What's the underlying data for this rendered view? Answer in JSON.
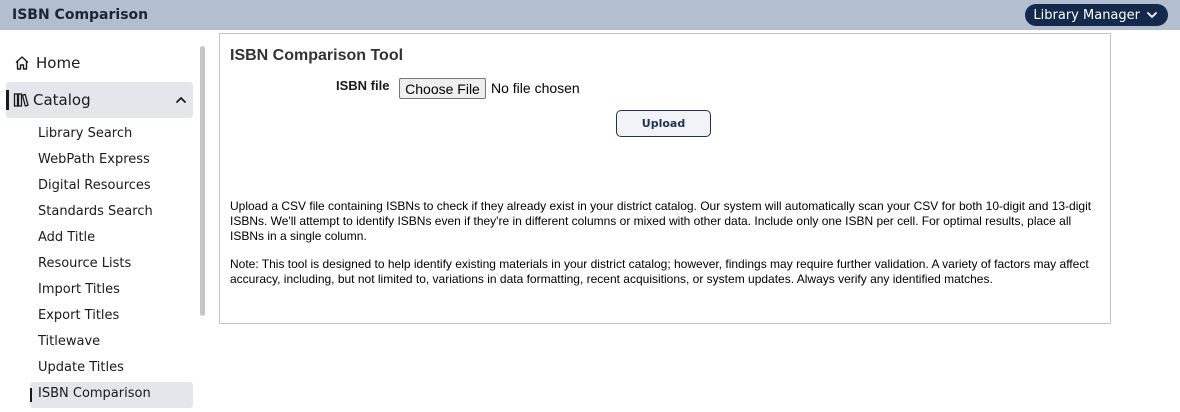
{
  "header": {
    "title": "ISBN Comparison",
    "role_menu_label": "Library Manager"
  },
  "sidebar": {
    "home_label": "Home",
    "catalog_label": "Catalog",
    "catalog_items": [
      "Library Search",
      "WebPath Express",
      "Digital Resources",
      "Standards Search",
      "Add Title",
      "Resource Lists",
      "Import Titles",
      "Export Titles",
      "Titlewave",
      "Update Titles",
      "ISBN Comparison"
    ],
    "active_item": "ISBN Comparison"
  },
  "main": {
    "title": "ISBN Comparison Tool",
    "file_label": "ISBN file",
    "choose_file_label": "Choose File",
    "file_status": "No file chosen",
    "upload_label": "Upload",
    "description": "Upload a CSV file containing ISBNs to check if they already exist in your district catalog. Our system will automatically scan your CSV for both 10-digit and 13-digit ISBNs. We'll attempt to identify ISBNs even if they're in different columns or mixed with other data. Include only one ISBN per cell. For optimal results, place all ISBNs in a single column.",
    "note": "Note: This tool is designed to help identify existing materials in your district catalog; however, findings may require further validation. A variety of factors may affect accuracy, including, but not limited to, variations in data formatting, recent acquisitions, or system updates. Always verify any identified matches."
  },
  "colors": {
    "topbar": "#b3bfcf",
    "role_button": "#142a4c",
    "nav_highlight": "#e3e7ec",
    "upload_border": "#1e3353"
  }
}
